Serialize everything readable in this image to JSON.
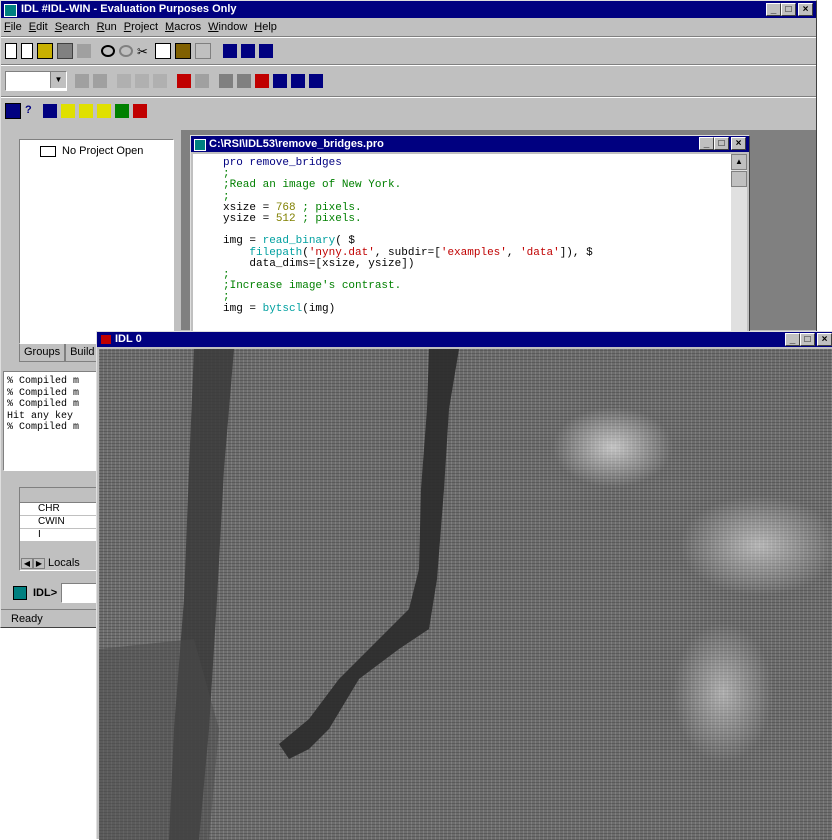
{
  "main_window": {
    "title": "IDL #IDL-WIN  - Evaluation Purposes Only",
    "menu": [
      "File",
      "Edit",
      "Search",
      "Run",
      "Project",
      "Macros",
      "Window",
      "Help"
    ],
    "project_tree_item": "No Project Open",
    "project_tabs": [
      "Groups",
      "Build C"
    ],
    "output_log": [
      "% Compiled m",
      "% Compiled m",
      "% Compiled m",
      "Hit any key",
      "% Compiled m"
    ],
    "variables": [
      "CHR",
      "CWIN",
      "I"
    ],
    "var_tab": "Locals",
    "command_prompt": "IDL>",
    "status": "Ready"
  },
  "editor_window": {
    "title": "C:\\RSI\\IDL53\\remove_bridges.pro",
    "code_lines": [
      [
        {
          "t": "pro remove_bridges",
          "c": "kw"
        }
      ],
      [
        {
          "t": ";",
          "c": "cm"
        }
      ],
      [
        {
          "t": ";Read an image of New York.",
          "c": "cm"
        }
      ],
      [
        {
          "t": ";",
          "c": "cm"
        }
      ],
      [
        {
          "t": "xsize = ",
          "c": "tx"
        },
        {
          "t": "768",
          "c": "num"
        },
        {
          "t": " ; pixels.",
          "c": "cm"
        }
      ],
      [
        {
          "t": "ysize = ",
          "c": "tx"
        },
        {
          "t": "512",
          "c": "num"
        },
        {
          "t": " ; pixels.",
          "c": "cm"
        }
      ],
      [
        {
          "t": "",
          "c": "tx"
        }
      ],
      [
        {
          "t": "img = ",
          "c": "tx"
        },
        {
          "t": "read_binary",
          "c": "fn"
        },
        {
          "t": "( $",
          "c": "tx"
        }
      ],
      [
        {
          "t": "    ",
          "c": "tx"
        },
        {
          "t": "filepath",
          "c": "fn"
        },
        {
          "t": "(",
          "c": "tx"
        },
        {
          "t": "'nyny.dat'",
          "c": "str"
        },
        {
          "t": ", subdir=[",
          "c": "tx"
        },
        {
          "t": "'examples'",
          "c": "str"
        },
        {
          "t": ", ",
          "c": "tx"
        },
        {
          "t": "'data'",
          "c": "str"
        },
        {
          "t": "]), $",
          "c": "tx"
        }
      ],
      [
        {
          "t": "    data_dims=[xsize, ysize])",
          "c": "tx"
        }
      ],
      [
        {
          "t": ";",
          "c": "cm"
        }
      ],
      [
        {
          "t": ";Increase image's contrast.",
          "c": "cm"
        }
      ],
      [
        {
          "t": ";",
          "c": "cm"
        }
      ],
      [
        {
          "t": "img = ",
          "c": "tx"
        },
        {
          "t": "bytscl",
          "c": "fn"
        },
        {
          "t": "(img)",
          "c": "tx"
        }
      ]
    ]
  },
  "graphics_window": {
    "title": "IDL 0"
  },
  "colors": {
    "title_active": "#000080",
    "face": "#c0c0c0"
  }
}
